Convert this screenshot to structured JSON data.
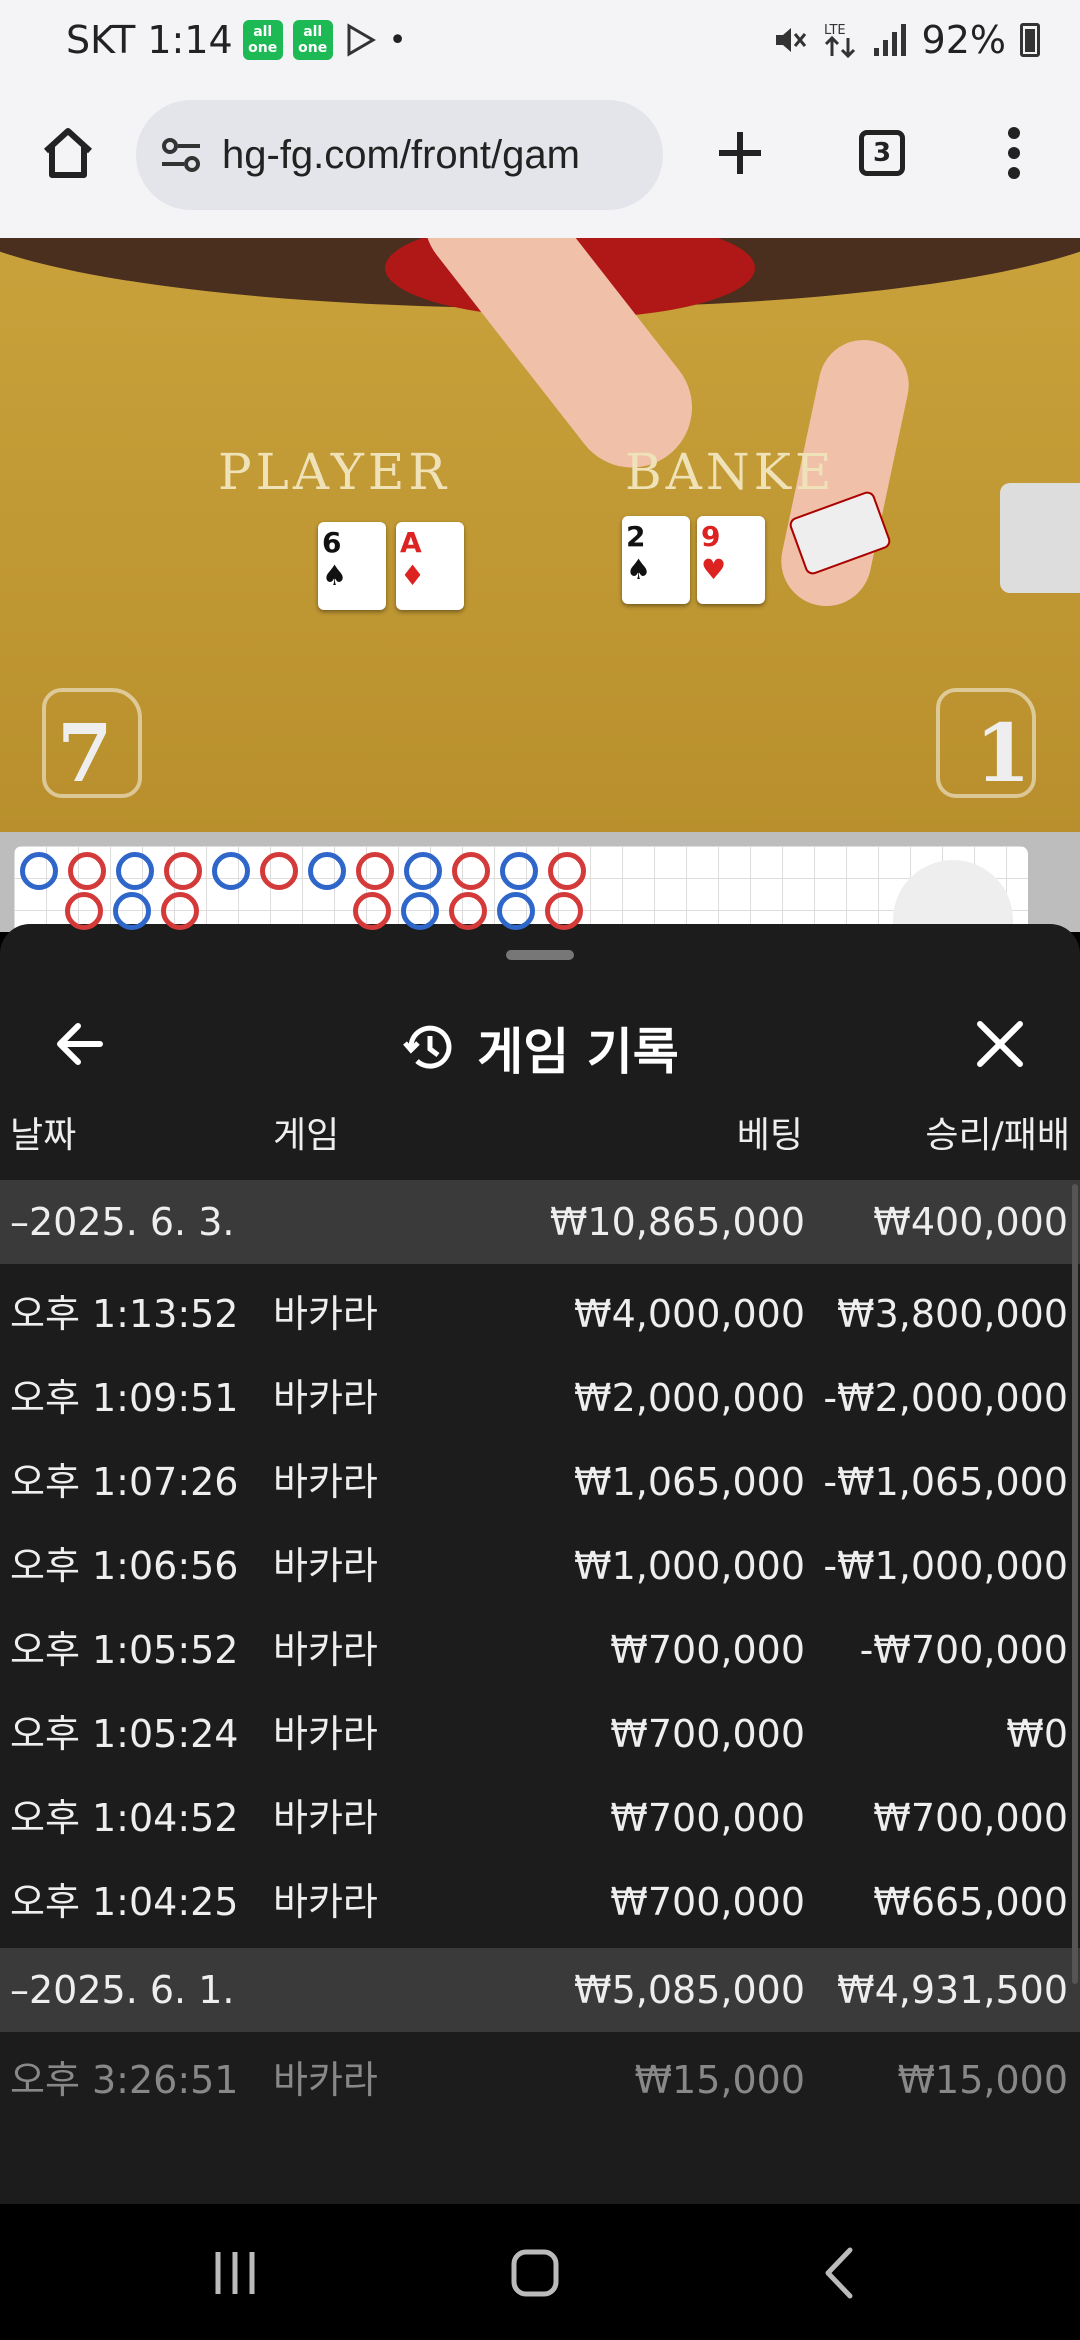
{
  "status_bar": {
    "carrier_time": "SKT 1:14",
    "battery": "92%",
    "app_badge_text": "all\none"
  },
  "browser": {
    "url": "hg-fg.com/front/gam",
    "tab_count": "3"
  },
  "game_video": {
    "player_label": "PLAYER",
    "banker_label": "BANKE",
    "player_cards": [
      {
        "rank": "6",
        "suit": "♠",
        "color": "black"
      },
      {
        "rank": "A",
        "suit": "♦",
        "color": "red"
      }
    ],
    "banker_cards": [
      {
        "rank": "2",
        "suit": "♠",
        "color": "black"
      },
      {
        "rank": "9",
        "suit": "♥",
        "color": "red"
      }
    ],
    "seat_left": "7",
    "seat_right": "1"
  },
  "sheet": {
    "title": "게임 기록",
    "columns": {
      "date": "날짜",
      "game": "게임",
      "bet": "베팅",
      "win_loss": "승리/패배"
    },
    "groups": [
      {
        "date": "–2025. 6. 3.",
        "bet": "₩10,865,000",
        "win_loss": "₩400,000",
        "rows": [
          {
            "time": "오후 1:13:52",
            "game": "바카라",
            "bet": "₩4,000,000",
            "win_loss": "₩3,800,000"
          },
          {
            "time": "오후 1:09:51",
            "game": "바카라",
            "bet": "₩2,000,000",
            "win_loss": "-₩2,000,000"
          },
          {
            "time": "오후 1:07:26",
            "game": "바카라",
            "bet": "₩1,065,000",
            "win_loss": "-₩1,065,000"
          },
          {
            "time": "오후 1:06:56",
            "game": "바카라",
            "bet": "₩1,000,000",
            "win_loss": "-₩1,000,000"
          },
          {
            "time": "오후 1:05:52",
            "game": "바카라",
            "bet": "₩700,000",
            "win_loss": "-₩700,000"
          },
          {
            "time": "오후 1:05:24",
            "game": "바카라",
            "bet": "₩700,000",
            "win_loss": "₩0"
          },
          {
            "time": "오후 1:04:52",
            "game": "바카라",
            "bet": "₩700,000",
            "win_loss": "₩700,000"
          },
          {
            "time": "오후 1:04:25",
            "game": "바카라",
            "bet": "₩700,000",
            "win_loss": "₩665,000"
          }
        ]
      },
      {
        "date": "–2025. 6. 1.",
        "bet": "₩5,085,000",
        "win_loss": "₩4,931,500",
        "rows": [
          {
            "time": "오후 3:26:51",
            "game": "바카라",
            "bet": "₩15,000",
            "win_loss": "₩15,000"
          }
        ]
      }
    ]
  },
  "colors": {
    "sheet_bg": "#1c1c1c",
    "group_row_bg": "#3a3a3a",
    "table_felt": "#c9a23c"
  }
}
